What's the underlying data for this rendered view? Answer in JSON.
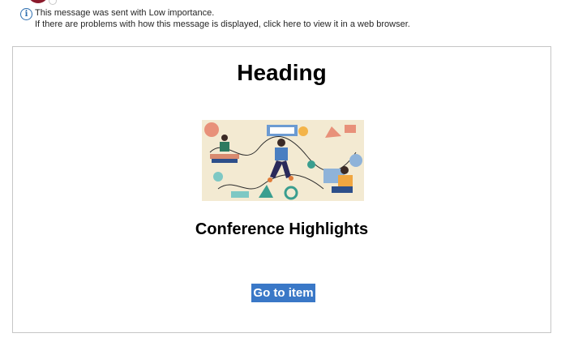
{
  "info_bar": {
    "icon": "info-icon",
    "line1": "This message was sent with Low importance.",
    "line2": "If there are problems with how this message is displayed, click here to view it in a web browser."
  },
  "email": {
    "heading": "Heading",
    "image": "conference-illustration",
    "subtitle": "Conference Highlights",
    "button_label": "Go to item",
    "accent_color": "#3a78c7"
  }
}
